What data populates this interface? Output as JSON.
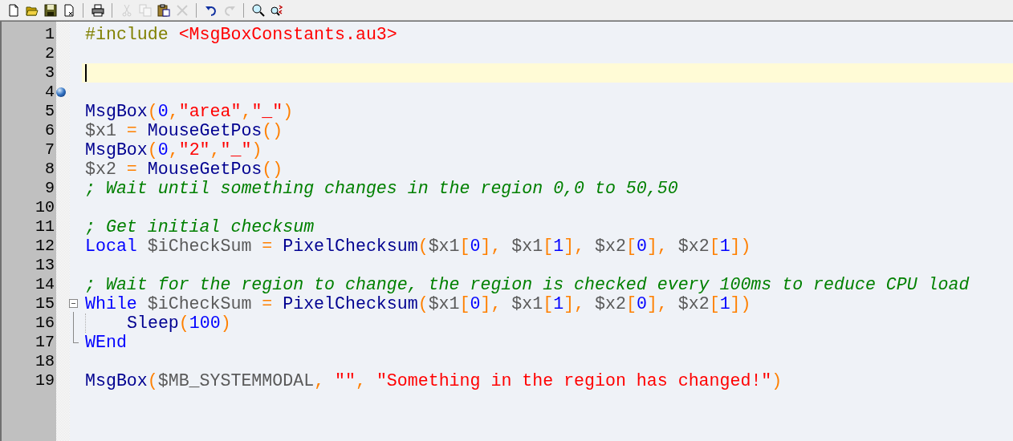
{
  "toolbar": [
    {
      "kind": "new",
      "disabled": false
    },
    {
      "kind": "open",
      "disabled": false
    },
    {
      "kind": "save",
      "disabled": false
    },
    {
      "kind": "close",
      "disabled": false
    },
    {
      "kind": "sep"
    },
    {
      "kind": "print",
      "disabled": false
    },
    {
      "kind": "sep"
    },
    {
      "kind": "cut",
      "disabled": true
    },
    {
      "kind": "copy",
      "disabled": true
    },
    {
      "kind": "paste",
      "disabled": false
    },
    {
      "kind": "delete",
      "disabled": true
    },
    {
      "kind": "sep"
    },
    {
      "kind": "undo",
      "disabled": false
    },
    {
      "kind": "redo",
      "disabled": true
    },
    {
      "kind": "sep"
    },
    {
      "kind": "find",
      "disabled": false
    },
    {
      "kind": "replace",
      "disabled": false
    }
  ],
  "editor": {
    "lines": [
      {
        "number": "1",
        "kind": "plain",
        "tokens": [
          {
            "kind": "directive",
            "text": "#include"
          },
          {
            "kind": "string",
            "gap": true,
            "text": "<MsgBoxConstants.au3>"
          }
        ]
      },
      {
        "number": "2",
        "kind": "plain"
      },
      {
        "number": "3",
        "kind": "plain",
        "current": true
      },
      {
        "number": "4",
        "kind": "plain",
        "bookmark": true
      },
      {
        "number": "5",
        "kind": "plain",
        "tokens": [
          {
            "kind": "function",
            "text": "MsgBox"
          },
          {
            "kind": "operator",
            "text": "("
          },
          {
            "kind": "number",
            "text": "0"
          },
          {
            "kind": "operator",
            "text": ","
          },
          {
            "kind": "string",
            "text": "\"area\""
          },
          {
            "kind": "operator",
            "text": ","
          },
          {
            "kind": "string",
            "text": "\"_\""
          },
          {
            "kind": "operator",
            "text": ")"
          }
        ]
      },
      {
        "number": "6",
        "kind": "plain",
        "tokens": [
          {
            "kind": "variable",
            "text": "$x1"
          },
          {
            "kind": "operator",
            "gap": true,
            "text": "="
          },
          {
            "kind": "function",
            "gap": true,
            "text": "MouseGetPos"
          },
          {
            "kind": "operator",
            "text": "()"
          }
        ]
      },
      {
        "number": "7",
        "kind": "plain",
        "tokens": [
          {
            "kind": "function",
            "text": "MsgBox"
          },
          {
            "kind": "operator",
            "text": "("
          },
          {
            "kind": "number",
            "text": "0"
          },
          {
            "kind": "operator",
            "text": ","
          },
          {
            "kind": "string",
            "text": "\"2\""
          },
          {
            "kind": "operator",
            "text": ","
          },
          {
            "kind": "string",
            "text": "\"_\""
          },
          {
            "kind": "operator",
            "text": ")"
          }
        ]
      },
      {
        "number": "8",
        "kind": "plain",
        "tokens": [
          {
            "kind": "variable",
            "text": "$x2"
          },
          {
            "kind": "operator",
            "gap": true,
            "text": "="
          },
          {
            "kind": "function",
            "gap": true,
            "text": "MouseGetPos"
          },
          {
            "kind": "operator",
            "text": "()"
          }
        ]
      },
      {
        "number": "9",
        "kind": "plain",
        "tokens": [
          {
            "kind": "comment",
            "text": "; Wait until something changes in the region 0,0 to 50,50"
          }
        ]
      },
      {
        "number": "10",
        "kind": "plain"
      },
      {
        "number": "11",
        "kind": "plain",
        "tokens": [
          {
            "kind": "comment",
            "text": "; Get initial checksum"
          }
        ]
      },
      {
        "number": "12",
        "kind": "plain",
        "tokens": [
          {
            "kind": "keyword",
            "text": "Local"
          },
          {
            "kind": "variable",
            "gap": true,
            "text": "$iCheckSum"
          },
          {
            "kind": "operator",
            "gap": true,
            "text": "="
          },
          {
            "kind": "function",
            "gap": true,
            "text": "PixelChecksum"
          },
          {
            "kind": "operator",
            "text": "("
          },
          {
            "kind": "variable",
            "text": "$x1"
          },
          {
            "kind": "operator",
            "text": "["
          },
          {
            "kind": "number",
            "text": "0"
          },
          {
            "kind": "operator",
            "text": "],"
          },
          {
            "kind": "variable",
            "gap": true,
            "text": "$x1"
          },
          {
            "kind": "operator",
            "text": "["
          },
          {
            "kind": "number",
            "text": "1"
          },
          {
            "kind": "operator",
            "text": "],"
          },
          {
            "kind": "variable",
            "gap": true,
            "text": "$x2"
          },
          {
            "kind": "operator",
            "text": "["
          },
          {
            "kind": "number",
            "text": "0"
          },
          {
            "kind": "operator",
            "text": "],"
          },
          {
            "kind": "variable",
            "gap": true,
            "text": "$x2"
          },
          {
            "kind": "operator",
            "text": "["
          },
          {
            "kind": "number",
            "text": "1"
          },
          {
            "kind": "operator",
            "text": "])"
          }
        ]
      },
      {
        "number": "13",
        "kind": "plain"
      },
      {
        "number": "14",
        "kind": "plain",
        "tokens": [
          {
            "kind": "comment",
            "text": "; Wait for the region to change, the region is checked every 100ms to reduce CPU load"
          }
        ]
      },
      {
        "number": "15",
        "kind": "fold_start",
        "tokens": [
          {
            "kind": "keyword",
            "text": "While"
          },
          {
            "kind": "variable",
            "gap": true,
            "text": "$iCheckSum"
          },
          {
            "kind": "operator",
            "gap": true,
            "text": "="
          },
          {
            "kind": "function",
            "gap": true,
            "text": "PixelChecksum"
          },
          {
            "kind": "operator",
            "text": "("
          },
          {
            "kind": "variable",
            "text": "$x1"
          },
          {
            "kind": "operator",
            "text": "["
          },
          {
            "kind": "number",
            "text": "0"
          },
          {
            "kind": "operator",
            "text": "],"
          },
          {
            "kind": "variable",
            "gap": true,
            "text": "$x1"
          },
          {
            "kind": "operator",
            "text": "["
          },
          {
            "kind": "number",
            "text": "1"
          },
          {
            "kind": "operator",
            "text": "],"
          },
          {
            "kind": "variable",
            "gap": true,
            "text": "$x2"
          },
          {
            "kind": "operator",
            "text": "["
          },
          {
            "kind": "number",
            "text": "0"
          },
          {
            "kind": "operator",
            "text": "],"
          },
          {
            "kind": "variable",
            "gap": true,
            "text": "$x2"
          },
          {
            "kind": "operator",
            "text": "["
          },
          {
            "kind": "number",
            "text": "1"
          },
          {
            "kind": "operator",
            "text": "])"
          }
        ]
      },
      {
        "number": "16",
        "kind": "fold_body",
        "indent": true,
        "tokens": [
          {
            "kind": "function",
            "text": "Sleep"
          },
          {
            "kind": "operator",
            "text": "("
          },
          {
            "kind": "number",
            "text": "100"
          },
          {
            "kind": "operator",
            "text": ")"
          }
        ]
      },
      {
        "number": "17",
        "kind": "fold_end",
        "tokens": [
          {
            "kind": "keyword",
            "text": "WEnd"
          }
        ]
      },
      {
        "number": "18",
        "kind": "plain"
      },
      {
        "number": "19",
        "kind": "plain",
        "tokens": [
          {
            "kind": "function",
            "text": "MsgBox"
          },
          {
            "kind": "operator",
            "text": "("
          },
          {
            "kind": "variable",
            "text": "$MB_SYSTEMMODAL"
          },
          {
            "kind": "operator",
            "text": ","
          },
          {
            "kind": "string",
            "gap": true,
            "text": "\"\""
          },
          {
            "kind": "operator",
            "text": ","
          },
          {
            "kind": "string",
            "gap": true,
            "text": "\"Something in the region has changed!\""
          },
          {
            "kind": "operator",
            "text": ")"
          }
        ]
      }
    ]
  }
}
